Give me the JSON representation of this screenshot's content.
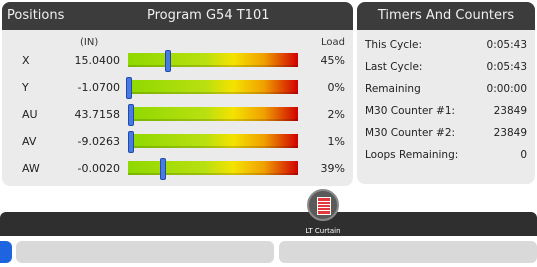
{
  "positions": {
    "title": "Positions",
    "program": "Program G54 T101",
    "units_header": "(IN)",
    "load_header": "Load",
    "rows": [
      {
        "axis": "X",
        "value": "15.0400",
        "marker_pct": 23,
        "load": "45%"
      },
      {
        "axis": "Y",
        "value": "-1.0700",
        "marker_pct": 0,
        "load": "0%"
      },
      {
        "axis": "AU",
        "value": "43.7158",
        "marker_pct": 1,
        "load": "2%"
      },
      {
        "axis": "AV",
        "value": "-9.0263",
        "marker_pct": 1,
        "load": "1%"
      },
      {
        "axis": "AW",
        "value": "-0.0020",
        "marker_pct": 20,
        "load": "39%"
      }
    ]
  },
  "timers": {
    "title": "Timers And Counters",
    "rows": [
      {
        "label": "This Cycle:",
        "value": "0:05:43"
      },
      {
        "label": "Last Cycle:",
        "value": "0:05:43"
      },
      {
        "label": "Remaining",
        "value": "0:00:00"
      },
      {
        "label": "M30 Counter #1:",
        "value": "23849"
      },
      {
        "label": "M30 Counter #2:",
        "value": "23849"
      },
      {
        "label": "Loops Remaining:",
        "value": "0"
      }
    ]
  },
  "status": {
    "curtain_label": "LT Curtain",
    "curtain_icon": "light-curtain-icon"
  },
  "colors": {
    "header_bg": "#3c3c3c",
    "panel_bg": "#ebebeb",
    "marker": "#4a79e0",
    "accent": "#1e63e0"
  }
}
